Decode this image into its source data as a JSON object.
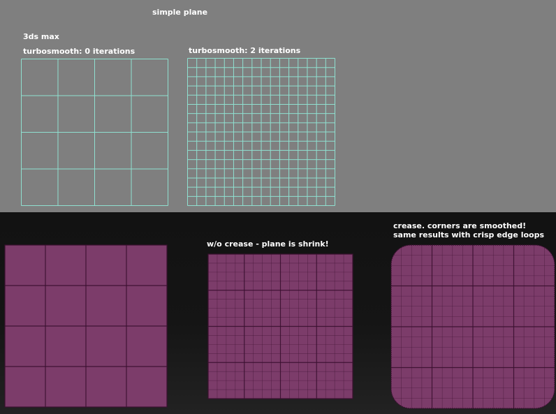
{
  "top": {
    "title": "simple plane",
    "app_label": "3ds max",
    "views": [
      {
        "caption": "turbosmooth: 0 iterations",
        "divisions": 4
      },
      {
        "caption": "turbosmooth: 2 iterations",
        "divisions": 16
      }
    ],
    "wire_color": "#8fe0d0",
    "background": "#7f7f7f"
  },
  "bottom": {
    "views": [
      {
        "caption": "",
        "divisions": 4,
        "sub_divisions": 1
      },
      {
        "caption": "w/o crease - plane is shrink!",
        "divisions": 4,
        "sub_divisions": 4
      },
      {
        "caption_lines": [
          "crease. corners are smoothed!",
          "same results with crisp edge loops"
        ],
        "divisions": 4,
        "sub_divisions": 4
      }
    ],
    "surface_color": "#7c3c6a",
    "edge_color": "#3a1030",
    "background": "#151515"
  }
}
